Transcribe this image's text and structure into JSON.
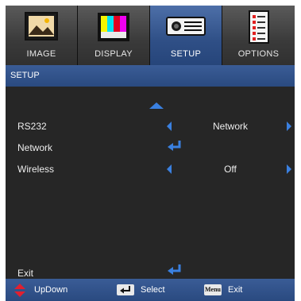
{
  "tabs": [
    {
      "label": "IMAGE",
      "icon": "image-icon",
      "active": false
    },
    {
      "label": "DISPLAY",
      "icon": "display-icon",
      "active": false
    },
    {
      "label": "SETUP",
      "icon": "projector-icon",
      "active": true
    },
    {
      "label": "OPTIONS",
      "icon": "options-icon",
      "active": false
    }
  ],
  "title": "SETUP",
  "rows": {
    "rs232": {
      "label": "RS232",
      "value": "Network"
    },
    "network": {
      "label": "Network"
    },
    "wireless": {
      "label": "Wireless",
      "value": "Off"
    },
    "exit": {
      "label": "Exit"
    }
  },
  "footer": {
    "updown_label": "UpDown",
    "select_label": "Select",
    "exit_label": "Exit",
    "menu_key_label": "Menu"
  },
  "colors": {
    "accent": "#3a80e0",
    "active_tab": "#2f4f86",
    "background": "#262626"
  }
}
